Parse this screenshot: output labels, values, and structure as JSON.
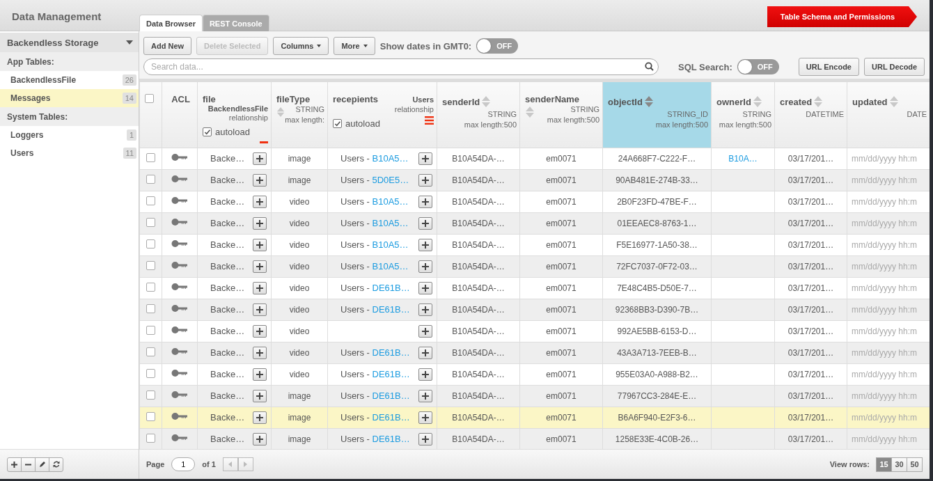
{
  "header": {
    "title": "Data Management",
    "tabs": [
      {
        "label": "Data Browser",
        "selected": true
      },
      {
        "label": "REST Console",
        "selected": false
      }
    ],
    "schema_button": "Table Schema and Permissions"
  },
  "sidebar": {
    "storage": "Backendless Storage",
    "sections": [
      {
        "label": "App Tables:",
        "items": [
          {
            "name": "BackendlessFile",
            "count": "26",
            "selected": false
          },
          {
            "name": "Messages",
            "count": "14",
            "selected": true
          }
        ]
      },
      {
        "label": "System Tables:",
        "items": [
          {
            "name": "Loggers",
            "count": "1",
            "selected": false
          },
          {
            "name": "Users",
            "count": "11",
            "selected": false
          }
        ]
      }
    ]
  },
  "toolbar": {
    "buttons": [
      {
        "label": "Add New",
        "kind": "button",
        "disabled": false
      },
      {
        "label": "Delete Selected",
        "kind": "button",
        "disabled": true
      },
      {
        "label": "Columns",
        "kind": "dropdown",
        "disabled": false
      },
      {
        "label": "More",
        "kind": "dropdown",
        "disabled": false
      }
    ],
    "gmt_toggle": {
      "label": "Show dates in GMT0:",
      "on": false,
      "text": "OFF"
    },
    "search": {
      "placeholder": "Search data..."
    },
    "sql_toggle": {
      "label": "SQL Search:",
      "on": false,
      "text": "OFF"
    },
    "url_buttons": [
      "URL Encode",
      "URL Decode"
    ]
  },
  "table": {
    "columns": [
      {
        "kind": "select",
        "checked": false
      },
      {
        "kind": "acl",
        "name": "ACL"
      },
      {
        "kind": "relation",
        "name": "file",
        "table": "BackendlessFile",
        "type": "relationship",
        "autoload": true,
        "autoload_label": "autoload",
        "menu": false
      },
      {
        "kind": "stacked",
        "name": "fileType",
        "type": "STRING",
        "max_length": "max length:",
        "selected": false
      },
      {
        "kind": "relation",
        "name": "recepients",
        "table": "Users",
        "type": "relationship",
        "autoload": true,
        "autoload_label": "autoload",
        "menu": true
      },
      {
        "kind": "field",
        "name": "senderId",
        "type": "STRING",
        "max_length": "max length:500",
        "selected": false
      },
      {
        "kind": "stacked",
        "name": "senderName",
        "type": "STRING",
        "max_length": "max length:500",
        "selected": false
      },
      {
        "kind": "field",
        "name": "objectId",
        "type": "STRING_ID",
        "max_length": "max length:500",
        "selected": true
      },
      {
        "kind": "field",
        "name": "ownerId",
        "type": "STRING",
        "max_length": "max length:500",
        "selected": false
      },
      {
        "kind": "field",
        "name": "created",
        "type": "DATETIME",
        "selected": false
      },
      {
        "kind": "field",
        "name": "updated",
        "type": "DATE",
        "selected": false
      }
    ],
    "rows": [
      {
        "checked": false,
        "selected": false,
        "file": "Backe…",
        "fileType": "image",
        "recepients": {
          "table": "Users - ",
          "id": "B10A5…"
        },
        "senderId": "B10A54DA-…",
        "senderName": "em0071",
        "objectId": "24A668F7-C222-F…",
        "ownerId": "B10A…",
        "created": "03/17/201…",
        "updated_placeholder": "mm/dd/yyyy hh:m"
      },
      {
        "checked": false,
        "selected": false,
        "file": "Backe…",
        "fileType": "image",
        "recepients": {
          "table": "Users - ",
          "id": "5D0E5…"
        },
        "senderId": "B10A54DA-…",
        "senderName": "em0071",
        "objectId": "90AB481E-274B-33…",
        "created": "03/17/201…",
        "updated_placeholder": "mm/dd/yyyy hh:m"
      },
      {
        "checked": false,
        "selected": false,
        "file": "Backe…",
        "fileType": "video",
        "recepients": {
          "table": "Users - ",
          "id": "B10A5…"
        },
        "senderId": "B10A54DA-…",
        "senderName": "em0071",
        "objectId": "2B0F23FD-47BE-F…",
        "created": "03/17/201…",
        "updated_placeholder": "mm/dd/yyyy hh:m"
      },
      {
        "checked": false,
        "selected": false,
        "file": "Backe…",
        "fileType": "video",
        "recepients": {
          "table": "Users - ",
          "id": "B10A5…"
        },
        "senderId": "B10A54DA-…",
        "senderName": "em0071",
        "objectId": "01EEAEC8-8763-1…",
        "created": "03/17/201…",
        "updated_placeholder": "mm/dd/yyyy hh:m"
      },
      {
        "checked": false,
        "selected": false,
        "file": "Backe…",
        "fileType": "video",
        "recepients": {
          "table": "Users - ",
          "id": "B10A5…"
        },
        "senderId": "B10A54DA-…",
        "senderName": "em0071",
        "objectId": "F5E16977-1A50-38…",
        "created": "03/17/201…",
        "updated_placeholder": "mm/dd/yyyy hh:m"
      },
      {
        "checked": false,
        "selected": false,
        "file": "Backe…",
        "fileType": "video",
        "recepients": {
          "table": "Users - ",
          "id": "B10A5…"
        },
        "senderId": "B10A54DA-…",
        "senderName": "em0071",
        "objectId": "72FC7037-0F72-03…",
        "created": "03/17/201…",
        "updated_placeholder": "mm/dd/yyyy hh:m"
      },
      {
        "checked": false,
        "selected": false,
        "file": "Backe…",
        "fileType": "video",
        "recepients": {
          "table": "Users - ",
          "id": "DE61B…"
        },
        "senderId": "B10A54DA-…",
        "senderName": "em0071",
        "objectId": "7E48C4B5-D50E-7…",
        "created": "03/17/201…",
        "updated_placeholder": "mm/dd/yyyy hh:m"
      },
      {
        "checked": false,
        "selected": false,
        "file": "Backe…",
        "fileType": "video",
        "recepients": {
          "table": "Users - ",
          "id": "DE61B…"
        },
        "senderId": "B10A54DA-…",
        "senderName": "em0071",
        "objectId": "92368BB3-D390-7B…",
        "created": "03/17/201…",
        "updated_placeholder": "mm/dd/yyyy hh:m"
      },
      {
        "checked": false,
        "selected": false,
        "file": "Backe…",
        "fileType": "video",
        "senderId": "B10A54DA-…",
        "senderName": "em0071",
        "objectId": "992AE5BB-6153-D…",
        "created": "03/17/201…",
        "updated_placeholder": "mm/dd/yyyy hh:m"
      },
      {
        "checked": false,
        "selected": false,
        "file": "Backe…",
        "fileType": "video",
        "recepients": {
          "table": "Users - ",
          "id": "DE61B…"
        },
        "senderId": "B10A54DA-…",
        "senderName": "em0071",
        "objectId": "43A3A713-7EEB-B…",
        "created": "03/17/201…",
        "updated_placeholder": "mm/dd/yyyy hh:m"
      },
      {
        "checked": false,
        "selected": false,
        "file": "Backe…",
        "fileType": "video",
        "recepients": {
          "table": "Users - ",
          "id": "DE61B…"
        },
        "senderId": "B10A54DA-…",
        "senderName": "em0071",
        "objectId": "955E03A0-A988-B2…",
        "created": "03/17/201…",
        "updated_placeholder": "mm/dd/yyyy hh:m"
      },
      {
        "checked": false,
        "selected": false,
        "file": "Backe…",
        "fileType": "image",
        "recepients": {
          "table": "Users - ",
          "id": "DE61B…"
        },
        "senderId": "B10A54DA-…",
        "senderName": "em0071",
        "objectId": "77967CC3-284E-E…",
        "created": "03/17/201…",
        "updated_placeholder": "mm/dd/yyyy hh:m"
      },
      {
        "checked": false,
        "selected": true,
        "file": "Backe…",
        "fileType": "image",
        "recepients": {
          "table": "Users - ",
          "id": "DE61B…"
        },
        "senderId": "B10A54DA-…",
        "senderName": "em0071",
        "objectId": "B6A6F940-E2F3-6…",
        "created": "03/17/201…",
        "updated_placeholder": "mm/dd/yyyy hh:m"
      },
      {
        "checked": false,
        "selected": false,
        "file": "Backe…",
        "fileType": "image",
        "recepients": {
          "table": "Users - ",
          "id": "DE61B…"
        },
        "senderId": "B10A54DA-…",
        "senderName": "em0071",
        "objectId": "1258E33E-4C0B-26…",
        "created": "03/17/201…",
        "updated_placeholder": "mm/dd/yyyy hh:m"
      }
    ]
  },
  "pager": {
    "label": "Page",
    "page": "1",
    "of": "of 1",
    "view_label": "View rows:",
    "sizes": [
      {
        "label": "15",
        "selected": true
      },
      {
        "label": "30",
        "selected": false
      },
      {
        "label": "50",
        "selected": false
      }
    ]
  }
}
